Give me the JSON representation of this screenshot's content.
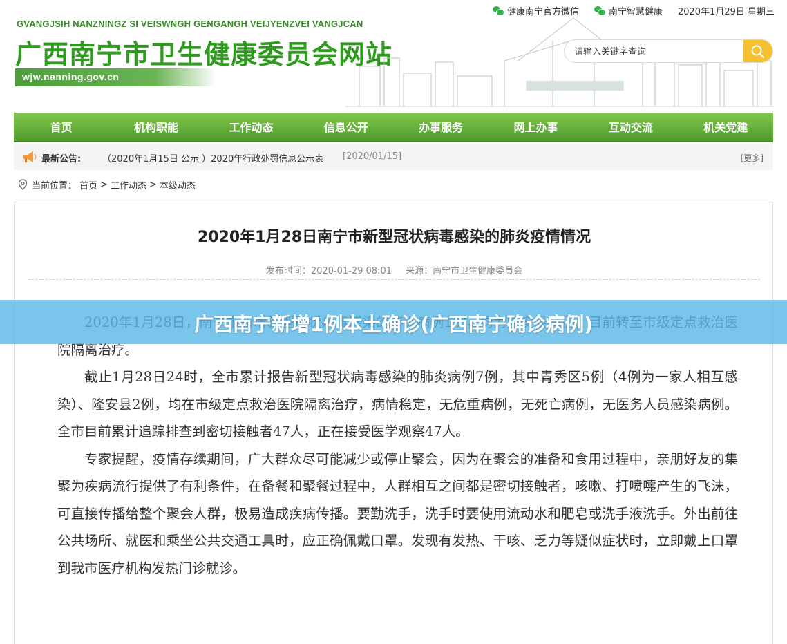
{
  "topbar": {
    "wechat_official": "健康南宁官方微信",
    "wechat_smart": "南宁智慧健康",
    "date": "2020年1月29日 星期三"
  },
  "site": {
    "pinyin": "GVANGJSIH NANZNINGZ SI VEISWNGH GENGANGH VEIJYENZVEI VANGJCAN",
    "name": "广西南宁市卫生健康委员会网站",
    "domain": "wjw.nanning.gov.cn"
  },
  "search": {
    "placeholder": "请输入关键字查询"
  },
  "nav": {
    "items": [
      {
        "label": "首页"
      },
      {
        "label": "机构职能"
      },
      {
        "label": "工作动态"
      },
      {
        "label": "信息公开"
      },
      {
        "label": "办事服务"
      },
      {
        "label": "网上办事"
      },
      {
        "label": "互动交流"
      },
      {
        "label": "机关党建"
      }
    ]
  },
  "notice": {
    "label": "最新公告:",
    "text": "（2020年1月15日 公示 ）2020年行政处罚信息公示表",
    "date": "[2020/01/15]",
    "more": "[更多]"
  },
  "breadcrumb": {
    "prefix": "当前位置：",
    "items": [
      "首页",
      "工作动态",
      "本级动态"
    ],
    "separator": ">"
  },
  "article": {
    "title": "2020年1月28日南宁市新型冠状病毒感染的肺炎疫情情况",
    "publish_time": "发布时间：2020-01-29 08:01",
    "source": "来源：南宁市卫生健康委员会",
    "paragraphs": [
      "2020年1月28日，南宁市新增新型冠状病毒感染的肺炎病例1例，均为隆安县病例，目前转至市级定点救治医院隔离治疗。",
      "截止1月28日24时，全市累计报告新型冠状病毒感染的肺炎病例7例，其中青秀区5例（4例为一家人相互感染）、隆安县2例，均在市级定点救治医院隔离治疗，病情稳定，无危重病例，无死亡病例，无医务人员感染病例。全市目前累计追踪排查到密切接触者47人，正在接受医学观察47人。",
      "专家提醒，疫情存续期间，广大群众尽可能减少或停止聚会，因为在聚会的准备和食用过程中，亲朋好友的集聚为疾病流行提供了有利条件，在备餐和聚餐过程中，人群相互之间都是密切接触者，咳嗽、打喷嚏产生的飞沫，可直接传播给整个聚会人群，极易造成疾病传播。要勤洗手，洗手时要使用流动水和肥皂或洗手液洗手。外出前往公共场所、就医和乘坐公共交通工具时，应正确佩戴口罩。发现有发热、干咳、乏力等疑似症状时，立即戴上口罩到我市医疗机构发热门诊就诊。"
    ]
  },
  "overlay": {
    "text": "广西南宁新增1例本土确诊(广西南宁确诊病例)"
  },
  "colors": {
    "brand_green": "#2e9a1e",
    "nav_green": "#4f9b2c",
    "search_button": "#f6c033",
    "overlay_blue": "#5cb8e8"
  }
}
